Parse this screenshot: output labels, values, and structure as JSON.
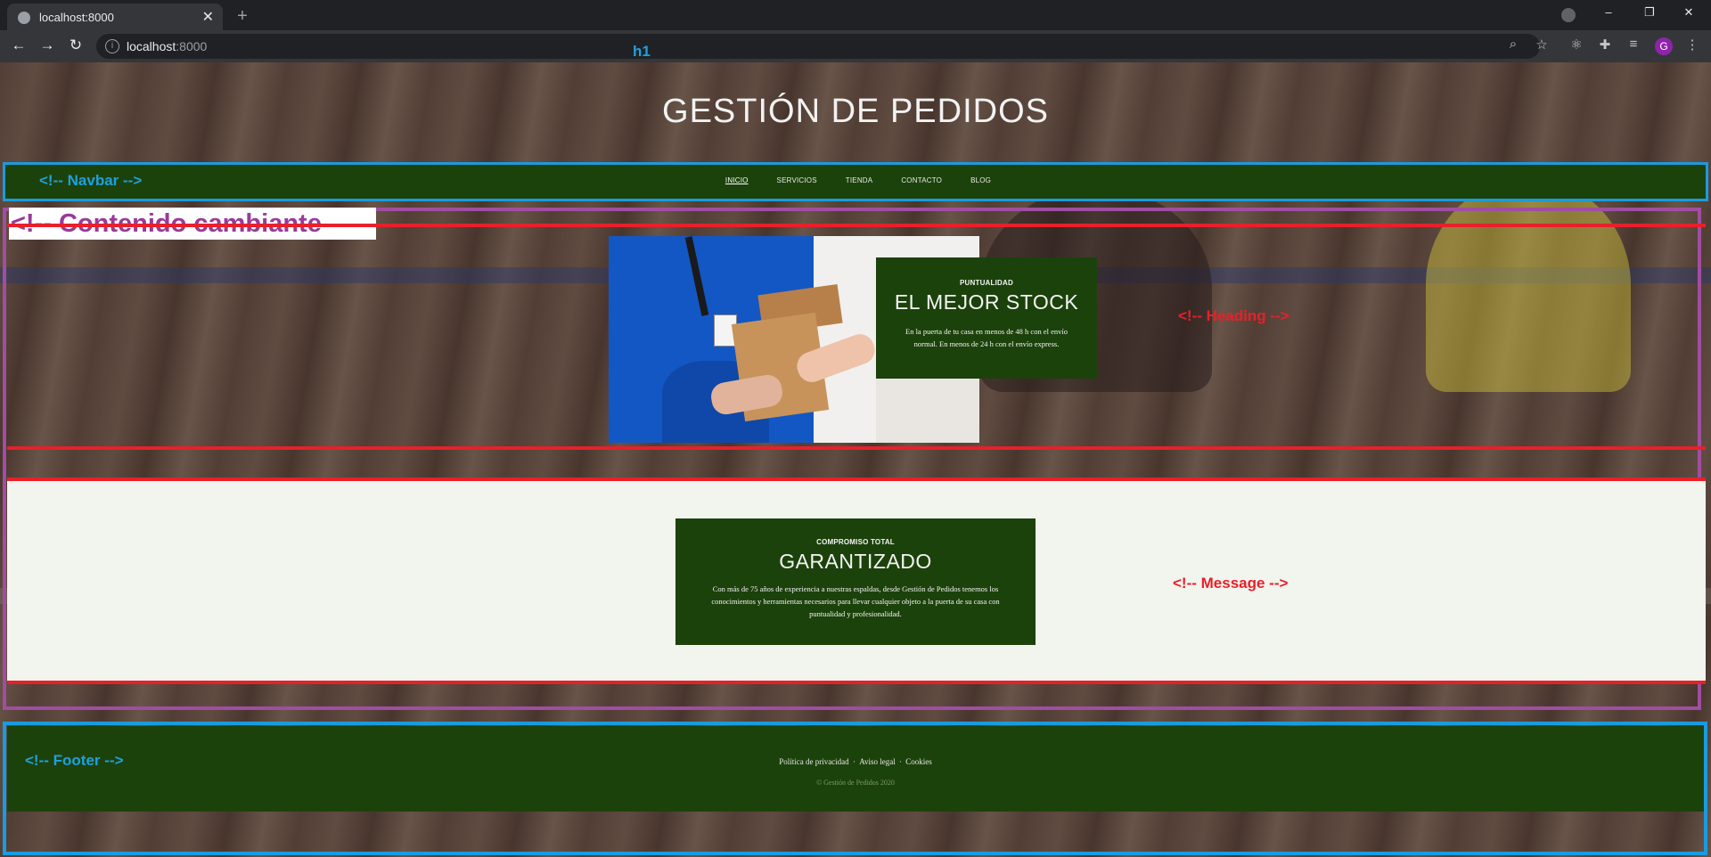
{
  "browser": {
    "tab_title": "localhost:8000",
    "tab_close": "✕",
    "new_tab": "+",
    "url_host": "localhost",
    "url_port": ":8000",
    "profile_initial": "G",
    "icons": [
      "back-icon",
      "forward-icon",
      "reload-icon",
      "info-icon",
      "zoom-icon",
      "star-icon",
      "react-devtools-icon",
      "extensions-icon",
      "reading-list-icon",
      "menu-icon"
    ]
  },
  "annotations": {
    "h1_label": "h1",
    "navbar": "<!-- Navbar -->",
    "content": "<!-- Contenido cambiante",
    "heading": "<!-- Heading -->",
    "message": "<!-- Message -->",
    "footer": "<!-- Footer -->"
  },
  "site": {
    "title": "GESTIÓN DE PEDIDOS",
    "nav": [
      "INICIO",
      "SERVICIOS",
      "TIENDA",
      "CONTACTO",
      "BLOG"
    ],
    "active_nav": "INICIO"
  },
  "heading_card": {
    "eyebrow": "PUNTUALIDAD",
    "title": "EL MEJOR STOCK",
    "text": "En la puerta de tu casa en menos de 48 h con el envío normal. En menos de 24 h con el envío express."
  },
  "message_card": {
    "eyebrow": "COMPROMISO TOTAL",
    "title": "GARANTIZADO",
    "text": "Con más de 75 años de experiencia a nuestras espaldas, desde Gestión de Pedidos tenemos los conocimientos y herramientas necesarios para llevar cualquier objeto a la puerta de su casa con puntualidad y profesionalidad."
  },
  "footer": {
    "links": [
      "Política de privacidad",
      "Aviso legal",
      "Cookies"
    ],
    "separator": "·",
    "copyright": "© Gestión de Pedidos 2020"
  },
  "colors": {
    "brand_green": "#1c420b",
    "annotation_blue": "#1a9be0",
    "annotation_purple": "#a04ea0",
    "annotation_red": "#e8202a"
  }
}
